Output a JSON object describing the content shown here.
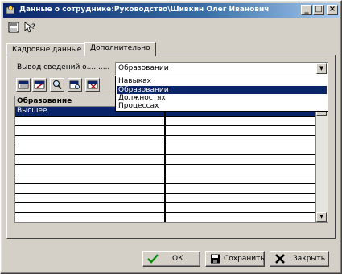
{
  "window": {
    "title": "Данные о сотруднике:Руководство\\Шивкин Олег Иванович",
    "controls": [
      "_",
      "□",
      "×"
    ]
  },
  "toolbar": {
    "icons": [
      "save-icon",
      "help-icon"
    ]
  },
  "tabs": [
    {
      "label": "Кадровые данные",
      "active": false
    },
    {
      "label": "Дополнительно",
      "active": true
    }
  ],
  "section": {
    "label": "Вывод сведений о..........",
    "combo_value": "Образовании",
    "dropdown_options": [
      "Навыках",
      "Образовании",
      "Должностях",
      "Процессах"
    ],
    "dropdown_selected": "Образовании"
  },
  "grid": {
    "column1_header": "Образование",
    "rows": [
      "Высшее",
      "",
      "",
      "",
      "",
      "",
      "",
      "",
      "",
      "",
      "",
      ""
    ]
  },
  "footer": {
    "ok_label": "ОК",
    "save_label": "Сохранить",
    "close_label": "Закрыть"
  },
  "colors": {
    "title_gradient_start": "#0a246a",
    "selection": "#0a246a",
    "face": "#d4d0c8"
  }
}
